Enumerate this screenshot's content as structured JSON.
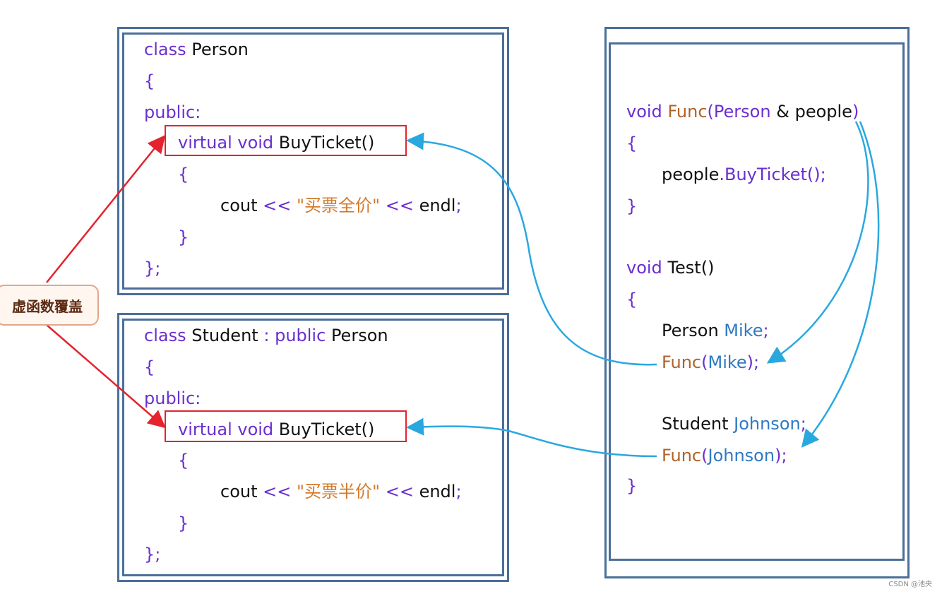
{
  "badge": {
    "label": "虚函数覆盖"
  },
  "person_class": {
    "l1_kw": "class",
    "l1_name": "Person",
    "l2": "{",
    "l3": "public:",
    "l4_kw": "virtual void",
    "l4_fn": "BuyTicket()",
    "l5": "{",
    "l6_a": "cout",
    "l6_op1": "<<",
    "l6_str": "\"买票全价\"",
    "l6_op2": "<<",
    "l6_b": "endl",
    "l6_semi": ";",
    "l7": "}",
    "l8": "};"
  },
  "student_class": {
    "l1_kw": "class",
    "l1_name": "Student",
    "l1_colon": ":",
    "l1_kw2": "public",
    "l1_base": "Person",
    "l2": "{",
    "l3": "public:",
    "l4_kw": "virtual void",
    "l4_fn": "BuyTicket()",
    "l5": "{",
    "l6_a": "cout",
    "l6_op1": "<<",
    "l6_str": "\"买票半价\"",
    "l6_op2": "<<",
    "l6_b": "endl",
    "l6_semi": ";",
    "l7": "}",
    "l8": "};"
  },
  "right_code": {
    "f1_kw": "void",
    "f1_name": "Func",
    "f1_paren": "(",
    "f1_type": "Person",
    "f1_amp": "&",
    "f1_param": "people",
    "f1_close": ")",
    "f2": "{",
    "f3_obj": "people",
    "f3_dot": ".",
    "f3_call": "BuyTicket();",
    "f4": "}",
    "t1_kw": "void",
    "t1_name": "Test()",
    "t2": "{",
    "t3_type": "Person",
    "t3_var": "Mike",
    "t3_semi": ";",
    "t4_fn": "Func",
    "t4_open": "(",
    "t4_var": "Mike",
    "t4_close": ");",
    "t5_type": "Student",
    "t5_var": "Johnson",
    "t5_semi": ";",
    "t6_fn": "Func",
    "t6_open": "(",
    "t6_var": "Johnson",
    "t6_close": ");",
    "t7": "}"
  },
  "colors": {
    "border": "#4a6f9a",
    "highlight": "#e5222e",
    "arrow_blue": "#29a8e0",
    "arrow_red": "#e5222e",
    "keyword": "#6a2fd0"
  },
  "watermark": "CSDN @池央"
}
